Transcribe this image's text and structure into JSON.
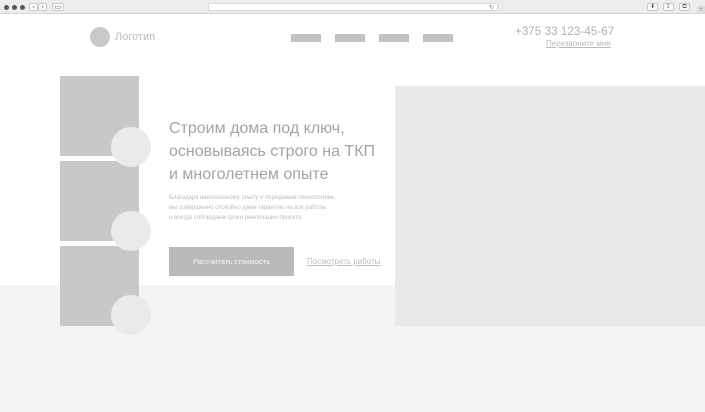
{
  "browser": {
    "back_glyph": "‹",
    "forward_glyph": "›",
    "sidebar_glyph": "▭",
    "reload_glyph": "↻",
    "share_glyph": "⇪",
    "tabs_glyph": "⧉",
    "download_glyph": "⬇",
    "corner_glyph": "+"
  },
  "header": {
    "logo_text": "Логотип",
    "nav_items": [
      "",
      "",
      "",
      ""
    ],
    "phone": "+375 33 123-45-67",
    "callback_link": "Перезвоните мне"
  },
  "hero": {
    "title_lines": [
      "Строим дома под ключ,",
      "основываясь строго на ТКП",
      "и многолетнем опыте"
    ],
    "description_lines": [
      "Благодаря накопленному опыту и передовым технологиям,",
      "мы совершенно спокойно даем гарантию на все работы",
      "и всегда соблюдаем сроки реализации проекта"
    ],
    "cta_button": "Рассчитать стоимость",
    "works_link": "Посмотреть работы"
  },
  "colors": {
    "placeholder_gray": "#c8c8c8",
    "light_gray": "#e9e9e9",
    "band_gray": "#f4f4f4"
  }
}
